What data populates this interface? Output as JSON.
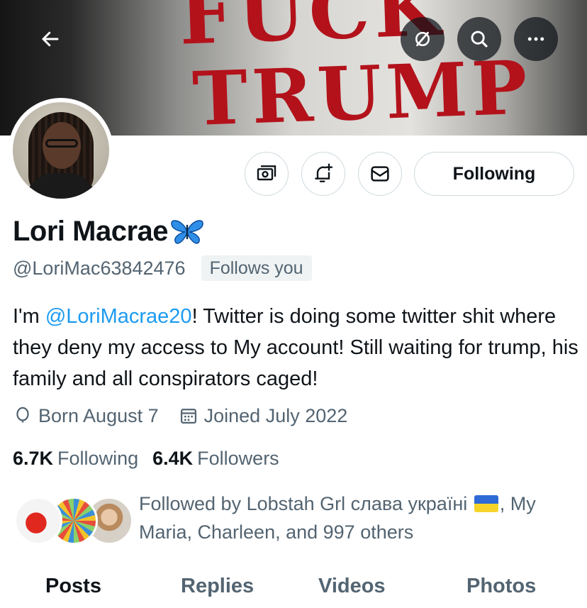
{
  "header": {
    "banner_text_line1": "FUCK",
    "banner_text_line2": "TRUMP",
    "back_icon": "arrow-left-icon",
    "buttons": [
      {
        "name": "translate-off-icon"
      },
      {
        "name": "search-icon"
      },
      {
        "name": "more-icon"
      }
    ]
  },
  "actions": {
    "tip_icon": "money-icon",
    "notify_icon": "bell-plus-icon",
    "message_icon": "envelope-icon",
    "follow_label": "Following"
  },
  "profile": {
    "display_name": "Lori Macrae",
    "handle": "@LoriMac63842476",
    "follows_you_badge": "Follows you",
    "bio_prefix": "I'm ",
    "bio_mention": "@LoriMacrae20",
    "bio_suffix": "! Twitter is doing some twitter shit where they deny my access to My account! Still waiting for trump, his family and all conspirators caged!",
    "birthday": "Born August 7",
    "joined": "Joined July 2022",
    "following_count": "6.7K",
    "following_label": "Following",
    "followers_count": "6.4K",
    "followers_label": "Followers",
    "followed_by_prefix": "Followed by Lobstah Grl слава україні",
    "followed_by_suffix": ", My Maria, Charleen, and 997 others"
  },
  "tabs": [
    {
      "label": "Posts",
      "active": true
    },
    {
      "label": "Replies",
      "active": false
    },
    {
      "label": "Videos",
      "active": false
    },
    {
      "label": "Photos",
      "active": false
    }
  ],
  "colors": {
    "accent": "#1d9bf0",
    "text_secondary": "#536471",
    "banner_red": "#b3121b"
  }
}
